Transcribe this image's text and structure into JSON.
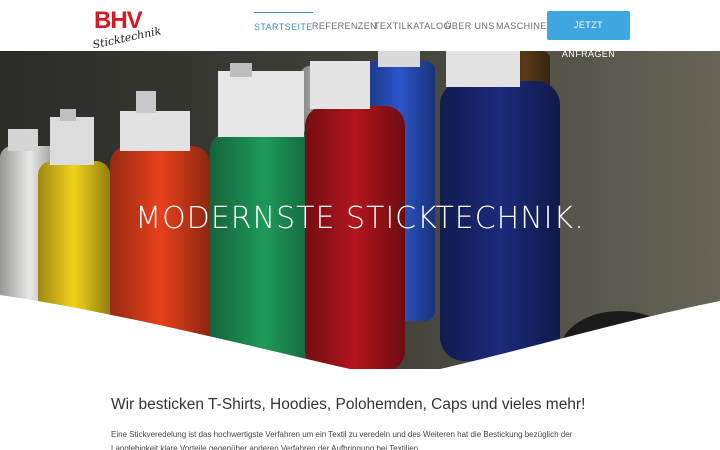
{
  "header": {
    "logo_text": "BHV",
    "logo_subtext": "Sticktechnik",
    "nav": [
      {
        "label": "STARTSEITE",
        "active": true
      },
      {
        "label": "REFERENZEN",
        "active": false
      },
      {
        "label": "TEXTILKATALOG",
        "active": false
      },
      {
        "label": "ÜBER UNS",
        "active": false
      },
      {
        "label": "MASCHINE",
        "active": false
      }
    ],
    "cta_label": "JETZT ANFRAGEN",
    "accent_color": "#3ea7e0",
    "logo_color": "#d71920"
  },
  "hero": {
    "title": "MODERNSTE STICKTECHNIK.",
    "image_icon": "thread-spools-photo",
    "spool_colors": [
      "#e8e8e6",
      "#f2d21a",
      "#e8401c",
      "#1e9a5a",
      "#b3151d",
      "#2a54c8",
      "#1b2a7a"
    ]
  },
  "main": {
    "heading": "Wir besticken T-Shirts, Hoodies, Polohemden, Caps und vieles mehr!",
    "paragraph": "Eine Stickveredelung ist das hochwertigste Verfahren um ein Textil zu veredeln und des Weiteren hat die Bestickung bezüglich der Langlebigkeit klare Vorteile gegenüber anderen Verfahren der Aufbringung bei Textilien."
  }
}
